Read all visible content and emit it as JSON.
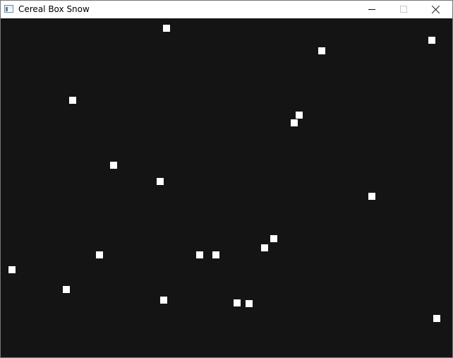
{
  "window": {
    "title": "Cereal Box Snow",
    "icon": "application-window-icon",
    "controls": [
      "minimize-icon",
      "maximize-icon",
      "close-icon"
    ]
  },
  "canvas": {
    "background_color": "#141414",
    "snowflake_color": "#ffffff",
    "snowflake_count": 20
  }
}
